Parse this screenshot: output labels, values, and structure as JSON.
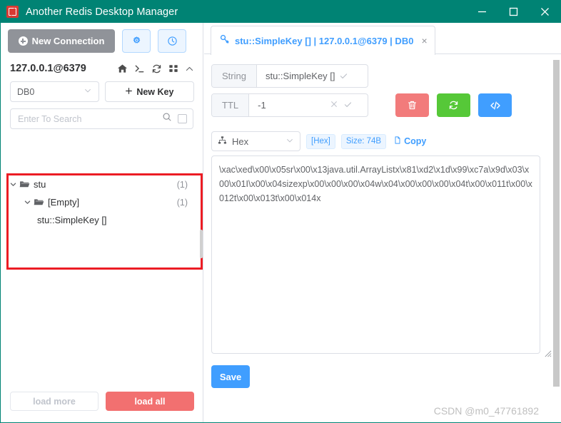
{
  "window": {
    "title": "Another Redis Desktop Manager",
    "icon": "redis-app-icon",
    "controls": {
      "minimize": "minimize-icon",
      "maximize": "maximize-icon",
      "close": "close-icon"
    },
    "titlebar_color": "#008374"
  },
  "sidebar": {
    "new_connection_label": "New Connection",
    "toolbar_icons": [
      {
        "name": "settings-icon"
      },
      {
        "name": "history-icon"
      }
    ],
    "connection": {
      "name": "127.0.0.1@6379",
      "icons": [
        {
          "name": "home-icon"
        },
        {
          "name": "console-icon"
        },
        {
          "name": "refresh-icon"
        },
        {
          "name": "grid-icon"
        },
        {
          "name": "chevron-up-icon"
        }
      ]
    },
    "db_select": {
      "value": "DB0"
    },
    "new_key_label": "New Key",
    "search": {
      "placeholder": "Enter To Search",
      "value": ""
    },
    "tree": [
      {
        "label": "stu",
        "count": "(1)",
        "level": 1,
        "expanded": true,
        "type": "folder"
      },
      {
        "label": "[Empty]",
        "count": "(1)",
        "level": 2,
        "expanded": true,
        "type": "folder"
      },
      {
        "label": "stu::SimpleKey []",
        "count": "",
        "level": 3,
        "expanded": false,
        "type": "key"
      }
    ],
    "footer": {
      "load_more_label": "load more",
      "load_all_label": "load all",
      "load_all_color": "#f27070"
    },
    "annotation": {
      "type": "red-rectangle",
      "color": "#ec1c24"
    }
  },
  "main": {
    "tab": {
      "title": "stu::SimpleKey [] | 127.0.0.1@6379 | DB0",
      "icon": "key-icon",
      "close": "×",
      "color": "#409eff"
    },
    "key_type_label": "String",
    "key_name_value": "stu::SimpleKey []",
    "ttl_label": "TTL",
    "ttl_value": "-1",
    "actions": [
      {
        "name": "delete-key-button",
        "icon": "trash-icon",
        "color": "#f27b7b"
      },
      {
        "name": "reload-key-button",
        "icon": "refresh-icon",
        "color": "#56c838"
      },
      {
        "name": "code-view-button",
        "icon": "code-icon",
        "color": "#409eff"
      }
    ],
    "viewer": {
      "format_value": "Hex",
      "format_icon": "sitemap-icon",
      "badge_format": "[Hex]",
      "badge_size": "Size: 74B",
      "copy_label": "Copy",
      "copy_icon": "copy-icon"
    },
    "content": "\\xac\\xed\\x00\\x05sr\\x00\\x13java.util.ArrayListx\\x81\\xd2\\x1d\\x99\\xc7a\\x9d\\x03\\x00\\x01I\\x00\\x04sizexp\\x00\\x00\\x00\\x04w\\x04\\x00\\x00\\x00\\x04t\\x00\\x011t\\x00\\x012t\\x00\\x013t\\x00\\x014x",
    "save_label": "Save"
  },
  "watermark": "CSDN @m0_47761892"
}
